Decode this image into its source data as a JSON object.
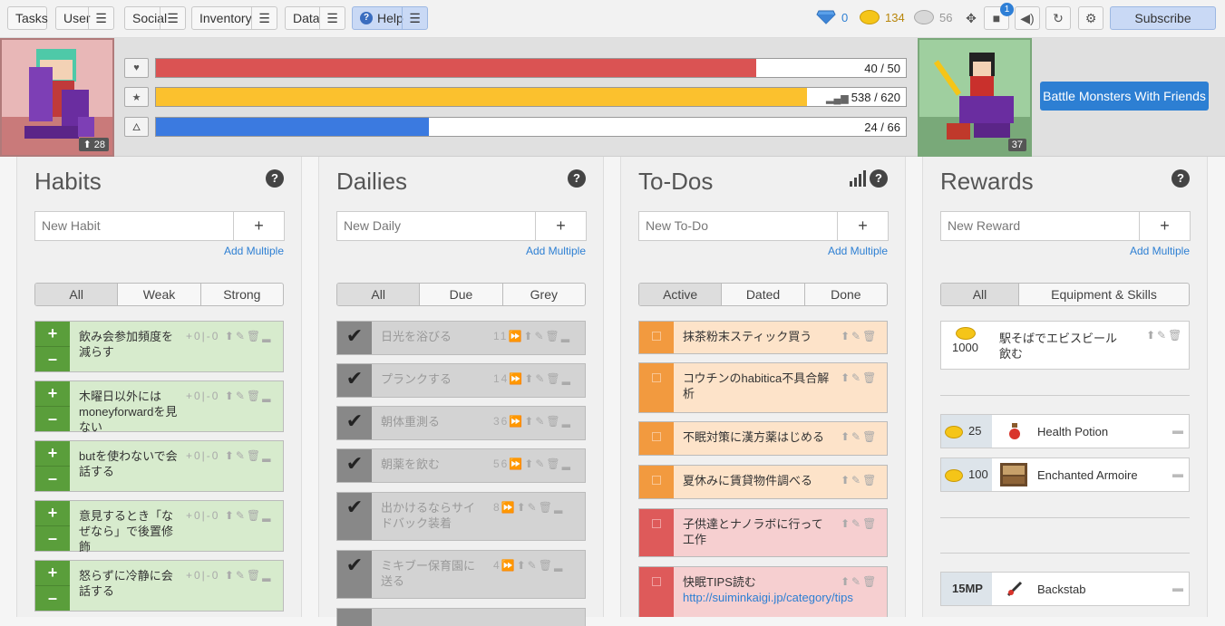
{
  "nav": {
    "tasks": "Tasks",
    "user": "User",
    "social": "Social",
    "inventory": "Inventory",
    "data": "Data",
    "help": "Help"
  },
  "currency": {
    "gems": "0",
    "gold": "134",
    "silver": "56"
  },
  "notif_count": "1",
  "subscribe": "Subscribe",
  "stats": {
    "hp": "40 / 50",
    "exp": "538 / 620",
    "mp": "24 / 66",
    "level": "28",
    "hp_fraction": 0.8,
    "exp_fraction": 0.868,
    "mp_fraction": 0.364
  },
  "party": {
    "level": "37",
    "cta": "Battle Monsters With Friends"
  },
  "habits": {
    "title": "Habits",
    "placeholder": "New Habit",
    "add_multiple": "Add Multiple",
    "filters": [
      "All",
      "Weak",
      "Strong"
    ],
    "items": [
      {
        "text": "飲み会参加頻度を減らす",
        "score": "+0|-0"
      },
      {
        "text": "木曜日以外にはmoneyforwardを見ない",
        "score": "+0|-0"
      },
      {
        "text": "butを使わないで会話する",
        "score": "+0|-0"
      },
      {
        "text": "意見するとき「なぜなら」で後置修飾",
        "score": "+0|-0"
      },
      {
        "text": "怒らずに冷静に会話する",
        "score": "+0|-0"
      }
    ]
  },
  "dailies": {
    "title": "Dailies",
    "placeholder": "New Daily",
    "add_multiple": "Add Multiple",
    "filters": [
      "All",
      "Due",
      "Grey"
    ],
    "items": [
      {
        "text": "日光を浴びる",
        "streak": "11"
      },
      {
        "text": "プランクする",
        "streak": "14"
      },
      {
        "text": "朝体重測る",
        "streak": "36"
      },
      {
        "text": "朝薬を飲む",
        "streak": "56"
      },
      {
        "text": "出かけるならサイドバック装着",
        "streak": "8"
      },
      {
        "text": "ミキブー保育園に送る",
        "streak": "4"
      }
    ]
  },
  "todos": {
    "title": "To-Dos",
    "placeholder": "New To-Do",
    "add_multiple": "Add Multiple",
    "filters": [
      "Active",
      "Dated",
      "Done"
    ],
    "items": [
      {
        "text": "抹茶粉末スティック買う"
      },
      {
        "text": "コウチンのhabitica不具合解析"
      },
      {
        "text": "不眠対策に漢方薬はじめる"
      },
      {
        "text": "夏休みに賃貸物件調べる"
      },
      {
        "text": "子供達とナノラボに行って工作"
      },
      {
        "text": "快眠TIPS読む",
        "link": "http://suiminkaigi.jp/category/tips"
      }
    ]
  },
  "rewards": {
    "title": "Rewards",
    "placeholder": "New Reward",
    "add_multiple": "Add Multiple",
    "filters": [
      "All",
      "Equipment & Skills"
    ],
    "custom": [
      {
        "price": "1000",
        "text": "駅そばでエビスビール飲む"
      }
    ],
    "items": [
      {
        "price": "25",
        "text": "Health Potion"
      },
      {
        "price": "100",
        "text": "Enchanted Armoire"
      }
    ],
    "skills": [
      {
        "price": "15MP",
        "text": "Backstab"
      }
    ]
  }
}
